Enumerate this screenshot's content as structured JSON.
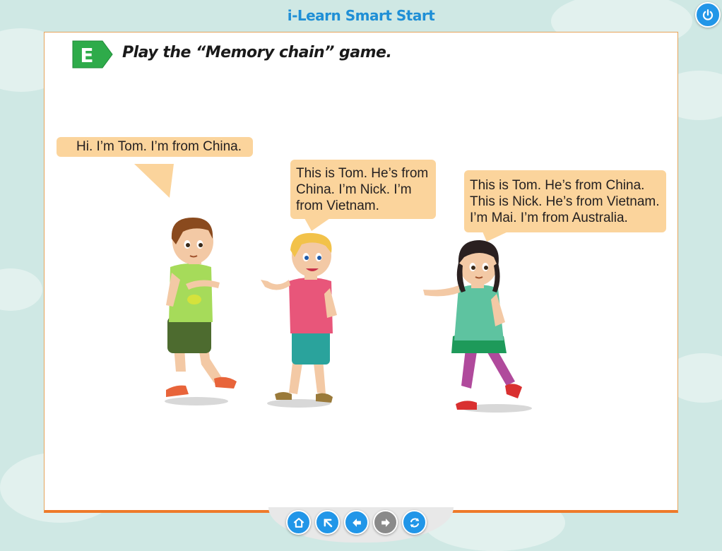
{
  "header": {
    "title": "i-Learn Smart Start"
  },
  "activity": {
    "badge_letter": "E",
    "instruction": "Play the “Memory chain”  game."
  },
  "bubbles": [
    {
      "lines": [
        "Hi. I’m Tom. I’m from China."
      ]
    },
    {
      "lines": [
        "This is Tom. He’s from",
        "China. I’m Nick. I’m",
        "from Vietnam."
      ]
    },
    {
      "lines": [
        "This is Tom. He’s from China.",
        "This is Nick. He’s from Vietnam.",
        "I’m Mai. I’m from Australia."
      ]
    }
  ],
  "navigation": {
    "buttons": [
      {
        "icon": "home-icon",
        "enabled": true
      },
      {
        "icon": "back-up-icon",
        "enabled": true
      },
      {
        "icon": "previous-icon",
        "enabled": true
      },
      {
        "icon": "next-icon",
        "enabled": false
      },
      {
        "icon": "replay-icon",
        "enabled": true
      }
    ]
  },
  "colors": {
    "accent": "#2196e8",
    "badge": "#2eab4a",
    "bubble": "#fbd49c",
    "panel_border": "#ee7a2a",
    "background": "#cfe8e4"
  }
}
